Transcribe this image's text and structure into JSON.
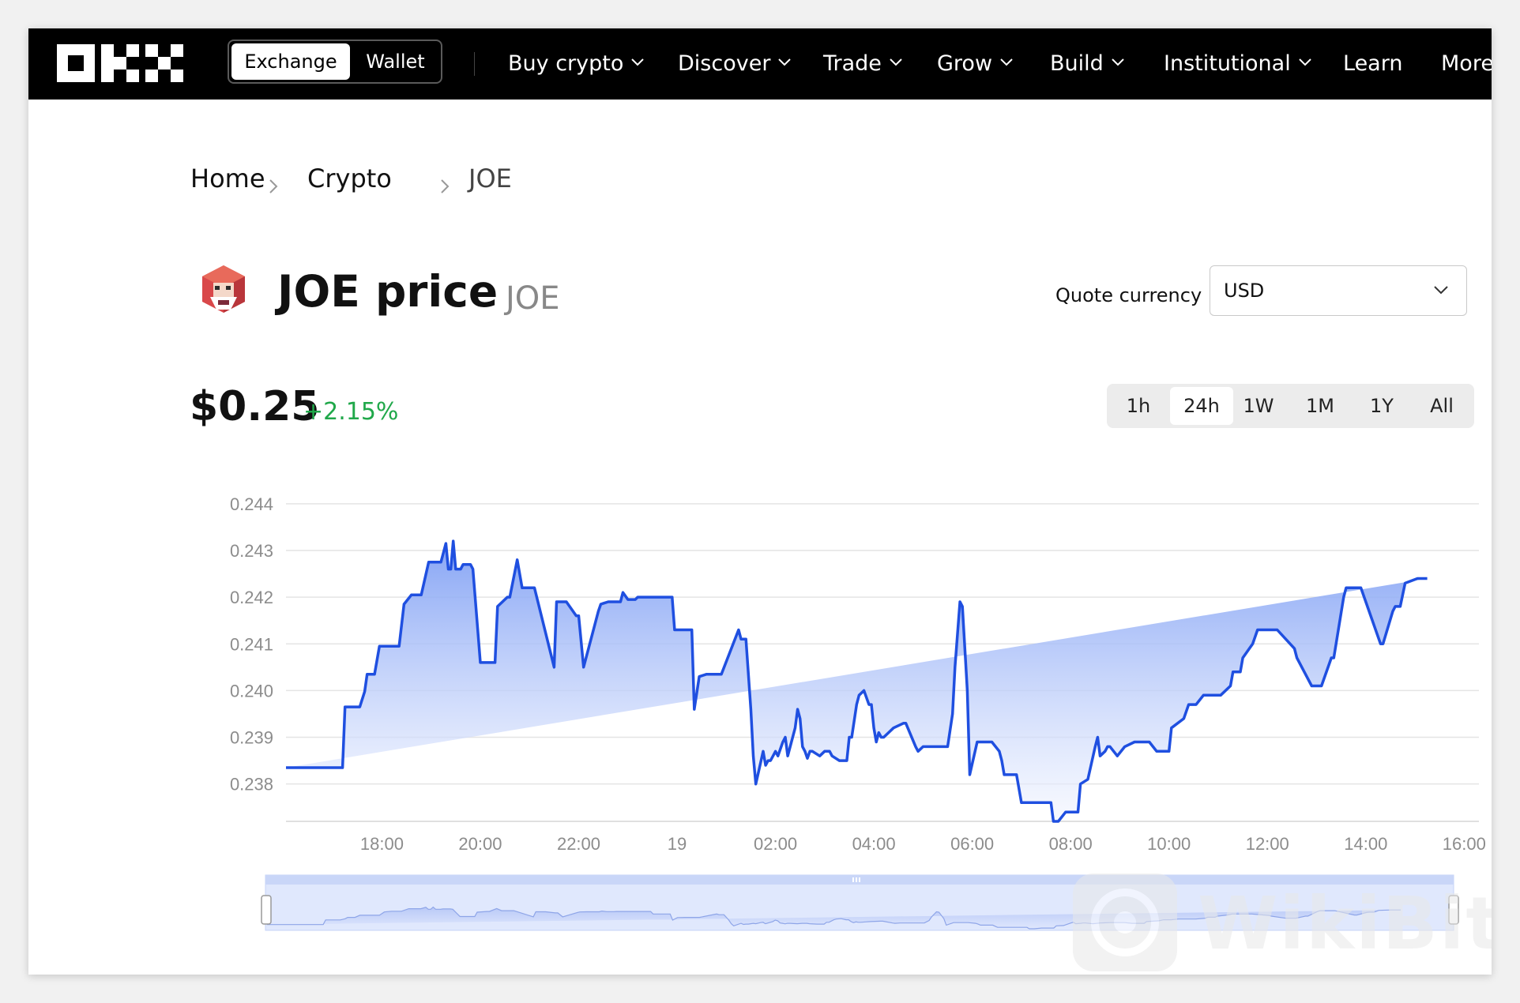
{
  "nav": {
    "logo_text": "OKX",
    "switch": {
      "active": "Exchange",
      "inactive": "Wallet"
    },
    "items": [
      {
        "label": "Buy crypto",
        "dropdown": true
      },
      {
        "label": "Discover",
        "dropdown": true
      },
      {
        "label": "Trade",
        "dropdown": true
      },
      {
        "label": "Grow",
        "dropdown": true
      },
      {
        "label": "Build",
        "dropdown": true
      },
      {
        "label": "Institutional",
        "dropdown": true
      },
      {
        "label": "Learn",
        "dropdown": false
      },
      {
        "label": "More",
        "dropdown": false
      }
    ]
  },
  "breadcrumb": {
    "home": "Home",
    "crypto": "Crypto",
    "current": "JOE"
  },
  "title": {
    "name": "JOE price",
    "ticker": "JOE",
    "icon": "joe-coin-logo"
  },
  "quote": {
    "label": "Quote currency",
    "value": "USD"
  },
  "price": {
    "value": "$0.25",
    "change": "+2.15%",
    "change_color": "#20a84a"
  },
  "range_tabs": {
    "options": [
      "1h",
      "24h",
      "1W",
      "1M",
      "1Y",
      "All"
    ],
    "selected": "24h"
  },
  "colors": {
    "line": "#1f4fe0",
    "area_top": "#7f9ff4",
    "area_bottom": "#f3f6ff",
    "grid": "#e4e4e4",
    "axis_text": "#8c8c8c"
  },
  "chart_data": {
    "type": "area",
    "yticks": [
      "0.244",
      "0.243",
      "0.242",
      "0.241",
      "0.240",
      "0.239",
      "0.238"
    ],
    "xticks": [
      "18:00",
      "20:00",
      "22:00",
      "19",
      "02:00",
      "04:00",
      "06:00",
      "08:00",
      "10:00",
      "12:00",
      "14:00",
      "16:00"
    ],
    "ylim": [
      0.2372,
      0.2442
    ],
    "grid": true,
    "x": [
      16.05,
      16.6,
      17.2,
      17.25,
      17.55,
      17.65,
      17.7,
      17.85,
      17.95,
      18.35,
      18.45,
      18.6,
      18.8,
      18.95,
      19.2,
      19.3,
      19.35,
      19.4,
      19.45,
      19.5,
      19.6,
      19.65,
      19.75,
      19.8,
      19.85,
      20.0,
      20.3,
      20.35,
      20.55,
      20.6,
      20.75,
      20.85,
      20.95,
      21.1,
      21.5,
      21.55,
      21.65,
      21.7,
      21.75,
      21.95,
      22.0,
      22.1,
      22.4,
      22.45,
      22.6,
      22.85,
      22.9,
      23.0,
      23.15,
      23.2,
      23.3,
      23.4,
      23.6,
      23.9,
      23.95,
      24.3,
      24.35,
      24.45,
      24.6,
      24.75,
      24.9,
      25.25,
      25.3,
      25.4,
      25.5,
      25.55,
      25.6,
      25.75,
      25.8,
      25.85,
      25.9,
      25.95,
      26.0,
      26.05,
      26.15,
      26.2,
      26.25,
      26.4,
      26.45,
      26.5,
      26.55,
      26.6,
      26.65,
      26.7,
      26.75,
      26.9,
      27.0,
      27.1,
      27.15,
      27.3,
      27.45,
      27.5,
      27.55,
      27.65,
      27.7,
      27.8,
      27.9,
      27.95,
      28.0,
      28.05,
      28.1,
      28.15,
      28.2,
      28.3,
      28.4,
      28.6,
      28.65,
      28.85,
      28.9,
      29.0,
      29.3,
      29.4,
      29.5,
      29.6,
      29.65,
      29.75,
      29.8,
      29.9,
      29.95,
      30.1,
      30.2,
      30.3,
      30.4,
      30.55,
      30.6,
      30.65,
      30.7,
      30.8,
      30.9,
      30.95,
      31.0,
      31.3,
      31.4,
      31.6,
      31.65,
      31.75,
      31.9,
      32.15,
      32.2,
      32.35,
      32.5,
      32.55,
      32.6,
      32.7,
      32.75,
      32.8,
      32.95,
      33.1,
      33.3,
      33.35,
      33.5,
      33.55,
      33.6,
      33.75,
      34.0,
      34.05,
      34.3,
      34.4,
      34.55,
      34.7,
      34.9,
      35.05,
      35.25,
      35.3,
      35.45,
      35.5,
      35.7,
      35.8,
      36.15,
      36.2,
      36.55,
      36.6,
      36.9,
      37.0,
      37.1,
      37.3,
      37.35,
      37.55,
      37.6,
      37.85,
      37.9,
      38.3,
      38.35,
      38.55,
      38.6,
      38.7,
      38.8,
      39.05,
      39.25,
      39.3,
      39.6,
      39.65,
      39.75,
      39.8,
      40.2,
      40.3
    ],
    "y": [
      0.23835,
      0.23835,
      0.23835,
      0.23965,
      0.23965,
      0.23998,
      0.24035,
      0.24035,
      0.24095,
      0.24095,
      0.24185,
      0.24205,
      0.24205,
      0.24275,
      0.24275,
      0.24315,
      0.2426,
      0.2426,
      0.2432,
      0.2426,
      0.2426,
      0.2427,
      0.2427,
      0.2427,
      0.2426,
      0.2406,
      0.2406,
      0.2418,
      0.242,
      0.242,
      0.2428,
      0.2422,
      0.2422,
      0.2422,
      0.2405,
      0.2419,
      0.2419,
      0.2419,
      0.2419,
      0.2416,
      0.2416,
      0.2405,
      0.2417,
      0.24185,
      0.2419,
      0.2419,
      0.2421,
      0.24195,
      0.24195,
      0.242,
      0.242,
      0.242,
      0.242,
      0.242,
      0.2413,
      0.2413,
      0.2396,
      0.2403,
      0.24035,
      0.24035,
      0.24035,
      0.2413,
      0.2411,
      0.2411,
      0.2396,
      0.2386,
      0.238,
      0.2387,
      0.2384,
      0.2385,
      0.2385,
      0.2386,
      0.2387,
      0.2386,
      0.2389,
      0.239,
      0.2386,
      0.2392,
      0.2396,
      0.2394,
      0.2388,
      0.2387,
      0.23855,
      0.2387,
      0.2387,
      0.2386,
      0.2387,
      0.2387,
      0.2386,
      0.2385,
      0.2385,
      0.239,
      0.239,
      0.2397,
      0.2399,
      0.24,
      0.2397,
      0.2397,
      0.2392,
      0.2389,
      0.2391,
      0.239,
      0.239,
      0.2391,
      0.2392,
      0.2393,
      0.2393,
      0.2388,
      0.2387,
      0.2388,
      0.2388,
      0.2388,
      0.2388,
      0.2395,
      0.2405,
      0.2419,
      0.2418,
      0.24,
      0.2382,
      0.2389,
      0.2389,
      0.2389,
      0.2389,
      0.2387,
      0.2385,
      0.2382,
      0.2382,
      0.2382,
      0.2382,
      0.2379,
      0.2376,
      0.2376,
      0.2376,
      0.2376,
      0.2372,
      0.2372,
      0.2374,
      0.2374,
      0.238,
      0.2381,
      0.2388,
      0.239,
      0.2386,
      0.2387,
      0.2388,
      0.2388,
      0.2386,
      0.2388,
      0.2389,
      0.2389,
      0.2389,
      0.2389,
      0.2389,
      0.2387,
      0.2387,
      0.2392,
      0.2394,
      0.2397,
      0.2397,
      0.2399,
      0.2399,
      0.2399,
      0.2401,
      0.2404,
      0.2404,
      0.2407,
      0.241,
      0.2413,
      0.2413,
      0.2413,
      0.2409,
      0.2407,
      0.2401,
      0.2401,
      0.2401,
      0.2407,
      0.2407,
      0.242,
      0.2422,
      0.2422,
      0.2422,
      0.241,
      0.241,
      0.2417,
      0.2418,
      0.2418,
      0.2423,
      0.2424,
      0.2424
    ]
  },
  "navigator": {
    "handle_icon": "drag-handle-icon"
  },
  "watermark": {
    "text": "WikiBit"
  }
}
